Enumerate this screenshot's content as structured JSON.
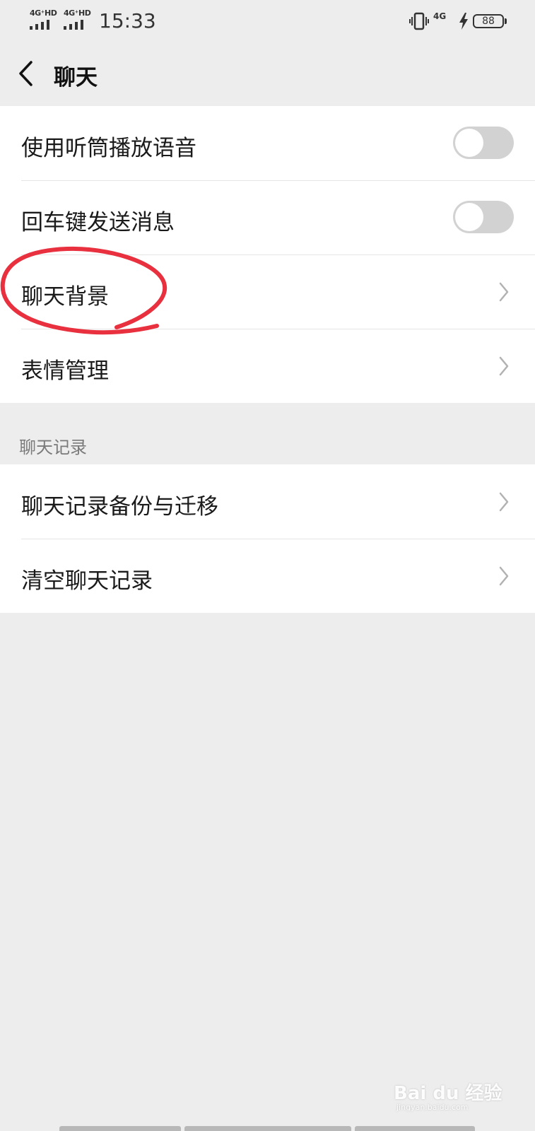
{
  "status_bar": {
    "sim1_network": "4G⁺HD",
    "sim2_network": "4G⁺HD",
    "time": "15:33",
    "right_network": "4G",
    "battery": "88"
  },
  "header": {
    "title": "聊天",
    "back_icon": "chevron-left-icon"
  },
  "settings_group": {
    "items": [
      {
        "label": "使用听筒播放语音",
        "control": "toggle",
        "on": false
      },
      {
        "label": "回车键发送消息",
        "control": "toggle",
        "on": false
      },
      {
        "label": "聊天背景",
        "control": "chevron"
      },
      {
        "label": "表情管理",
        "control": "chevron"
      }
    ]
  },
  "history_section": {
    "header": "聊天记录",
    "items": [
      {
        "label": "聊天记录备份与迁移",
        "control": "chevron"
      },
      {
        "label": "清空聊天记录",
        "control": "chevron"
      }
    ]
  },
  "annotation": {
    "shape": "hand-drawn-circle",
    "color": "#e8303f",
    "target": "聊天背景"
  },
  "watermark": {
    "text": "Bai du 经验",
    "url": "jingyan.baidu.com"
  },
  "colors": {
    "background": "#ededed",
    "card": "#ffffff",
    "toggle_off": "#d2d2d2",
    "annotation": "#e8303f"
  }
}
